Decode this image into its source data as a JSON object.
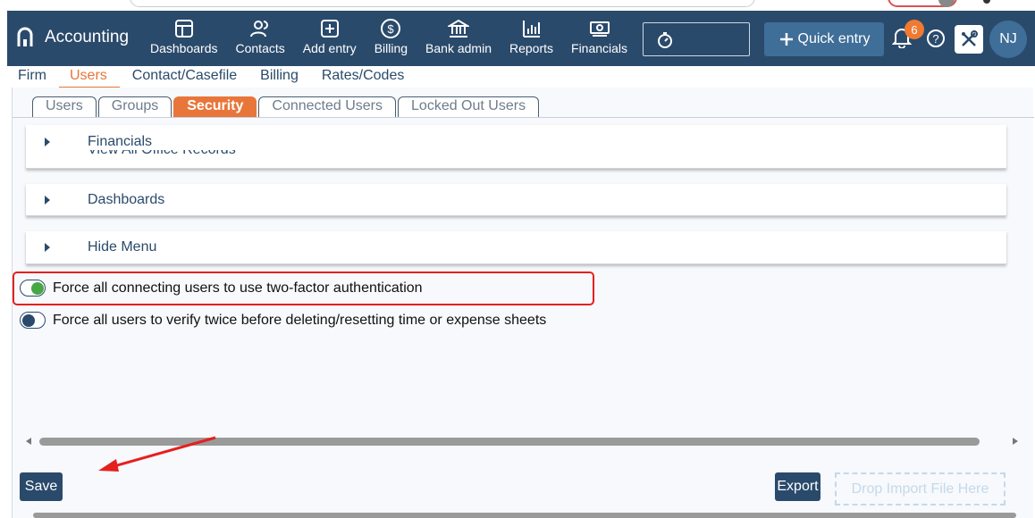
{
  "app": {
    "title": "Accounting"
  },
  "nav": [
    {
      "label": "Dashboards",
      "icon": "dashboard-icon"
    },
    {
      "label": "Contacts",
      "icon": "contacts-icon"
    },
    {
      "label": "Add entry",
      "icon": "add-entry-icon"
    },
    {
      "label": "Billing",
      "icon": "billing-icon"
    },
    {
      "label": "Bank admin",
      "icon": "bank-icon"
    },
    {
      "label": "Reports",
      "icon": "reports-icon"
    },
    {
      "label": "Financials",
      "icon": "financials-icon"
    }
  ],
  "header": {
    "quick_entry_label": "Quick entry",
    "notification_count": "6",
    "avatar_initials": "NJ"
  },
  "subnav": [
    {
      "label": "Firm",
      "active": false
    },
    {
      "label": "Users",
      "active": true
    },
    {
      "label": "Contact/Casefile",
      "active": false
    },
    {
      "label": "Billing",
      "active": false
    },
    {
      "label": "Rates/Codes",
      "active": false
    }
  ],
  "tabs": [
    {
      "label": "Users",
      "active": false
    },
    {
      "label": "Groups",
      "active": false
    },
    {
      "label": "Security",
      "active": true
    },
    {
      "label": "Connected Users",
      "active": false
    },
    {
      "label": "Locked Out Users",
      "active": false
    }
  ],
  "panels": [
    {
      "label": "Financials",
      "ghost": "View All Office Records"
    },
    {
      "label": "Dashboards"
    },
    {
      "label": "Hide Menu"
    }
  ],
  "toggles": [
    {
      "label": "Force all connecting users to use two-factor authentication",
      "on": true
    },
    {
      "label": "Force all users to verify twice before deleting/resetting time or expense sheets",
      "on": false
    }
  ],
  "actions": {
    "save_label": "Save",
    "export_label": "Export",
    "drop_label": "Drop Import File Here"
  },
  "colors": {
    "appbar": "#2a4a6b",
    "accent": "#e8763a",
    "toggle_on": "#47a645",
    "annotation": "#e51f1f"
  }
}
